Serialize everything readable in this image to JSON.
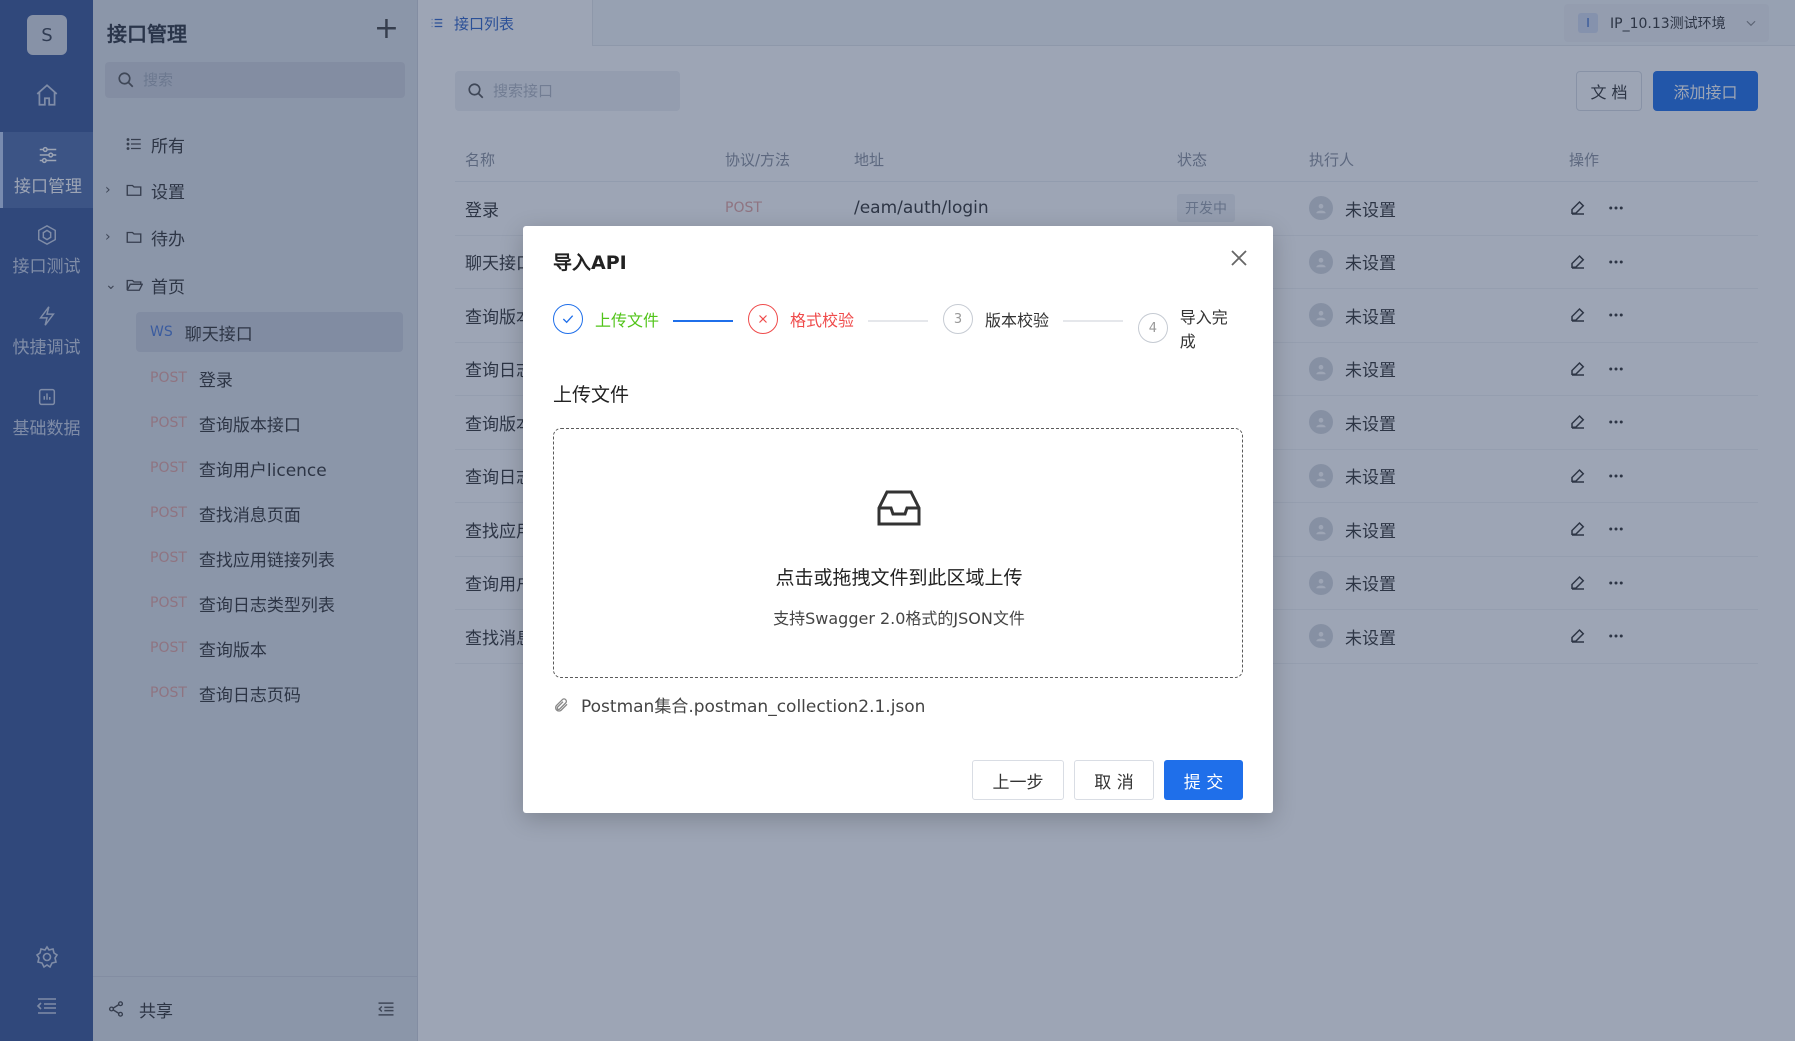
{
  "nav": {
    "avatar": "S",
    "items": [
      {
        "label": "接口管理"
      },
      {
        "label": "接口测试"
      },
      {
        "label": "快捷调试"
      },
      {
        "label": "基础数据"
      }
    ]
  },
  "sidebar": {
    "title": "接口管理",
    "add": "+",
    "search_placeholder": "搜索",
    "tree": [
      {
        "label": "所有"
      },
      {
        "label": "设置"
      },
      {
        "label": "待办"
      },
      {
        "label": "首页"
      }
    ],
    "apis": [
      {
        "method": "WS",
        "name": "聊天接口"
      },
      {
        "method": "POST",
        "name": "登录"
      },
      {
        "method": "POST",
        "name": "查询版本接口"
      },
      {
        "method": "POST",
        "name": "查询用户licence"
      },
      {
        "method": "POST",
        "name": "查找消息页面"
      },
      {
        "method": "POST",
        "name": "查找应用链接列表"
      },
      {
        "method": "POST",
        "name": "查询日志类型列表"
      },
      {
        "method": "POST",
        "name": "查询版本"
      },
      {
        "method": "POST",
        "name": "查询日志页码"
      }
    ],
    "footer": "共享"
  },
  "main": {
    "tab": "接口列表",
    "env_tag": "I",
    "env": "IP_10.13测试环境",
    "search_placeholder": "搜索接口",
    "doc_btn": "文 档",
    "add_btn": "添加接口",
    "headers": [
      "名称",
      "协议/方法",
      "地址",
      "状态",
      "执行人",
      "操作"
    ],
    "rows": [
      {
        "name": "登录",
        "method": "POST",
        "addr": "/eam/auth/login",
        "status": "开发中",
        "exec": "未设置"
      },
      {
        "name": "聊天接口",
        "method": "",
        "addr": "",
        "status": "",
        "exec": "未设置"
      },
      {
        "name": "查询版本",
        "method": "",
        "addr": "",
        "status": "",
        "exec": "未设置"
      },
      {
        "name": "查询日志",
        "method": "",
        "addr": "",
        "status": "",
        "exec": "未设置"
      },
      {
        "name": "查询版本",
        "method": "",
        "addr": "",
        "status": "",
        "exec": "未设置"
      },
      {
        "name": "查询日志",
        "method": "",
        "addr": "",
        "status": "",
        "exec": "未设置"
      },
      {
        "name": "查找应用",
        "method": "",
        "addr": "",
        "status": "",
        "exec": "未设置"
      },
      {
        "name": "查询用户",
        "method": "",
        "addr": "",
        "status": "",
        "exec": "未设置"
      },
      {
        "name": "查找消息",
        "method": "",
        "addr": "",
        "status": "",
        "exec": "未设置"
      }
    ]
  },
  "modal": {
    "title": "导入API",
    "steps": [
      {
        "num": "",
        "label": "上传文件",
        "state": "done"
      },
      {
        "num": "",
        "label": "格式校验",
        "state": "error"
      },
      {
        "num": "3",
        "label": "版本校验",
        "state": "wait"
      },
      {
        "num": "4",
        "label": "导入完成",
        "state": "wait"
      }
    ],
    "section": "上传文件",
    "drop_main": "点击或拖拽文件到此区域上传",
    "drop_hint": "支持Swagger 2.0格式的JSON文件",
    "file": "Postman集合.postman_collection2.1.json",
    "prev": "上一步",
    "cancel": "取 消",
    "submit": "提 交"
  },
  "colors": {
    "nav_bg": "#3a5795",
    "primary": "#1f6fea",
    "success": "#52c41a",
    "error": "#ef4b4b",
    "post": "#e6a6a1"
  }
}
